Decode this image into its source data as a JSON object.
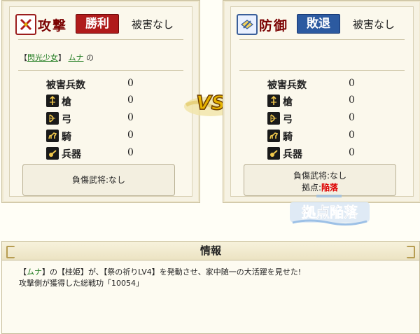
{
  "attack": {
    "mode": "攻撃",
    "result": "勝利",
    "damage": "被害なし",
    "who_prefix": "【",
    "general": "閃光少女",
    "who_mid": "】",
    "name": "ムナ",
    "who_suffix": "の",
    "casualties_label": "被害兵数",
    "casualties": "0",
    "units": [
      {
        "label": "槍",
        "value": "0",
        "icon": "spear-icon"
      },
      {
        "label": "弓",
        "value": "0",
        "icon": "bow-icon"
      },
      {
        "label": "騎",
        "value": "0",
        "icon": "horse-icon"
      },
      {
        "label": "兵器",
        "value": "0",
        "icon": "siege-icon"
      }
    ],
    "wounded": "負傷武将:なし"
  },
  "defense": {
    "mode": "防御",
    "result": "敗退",
    "damage": "被害なし",
    "casualties_label": "被害兵数",
    "casualties": "0",
    "units": [
      {
        "label": "槍",
        "value": "0",
        "icon": "spear-icon"
      },
      {
        "label": "弓",
        "value": "0",
        "icon": "bow-icon"
      },
      {
        "label": "騎",
        "value": "0",
        "icon": "horse-icon"
      },
      {
        "label": "兵器",
        "value": "0",
        "icon": "siege-icon"
      }
    ],
    "wounded": "負傷武将:なし",
    "base_label": "拠点:",
    "base_status": "陥落"
  },
  "vs": "VS",
  "fallen_banner": "拠点陥落",
  "info": {
    "title": "情報",
    "line1_a": "【",
    "line1_name": "ムナ",
    "line1_b": "】の【桂姫】が、【祭の祈りLV4】を発動させ、家中随一の大活躍を見せた!",
    "line2": "攻撃側が獲得した総戦功「10054」"
  },
  "colors": {
    "win": "#b01b1b",
    "lose": "#2c5aa0",
    "fall": "#dd0000"
  }
}
